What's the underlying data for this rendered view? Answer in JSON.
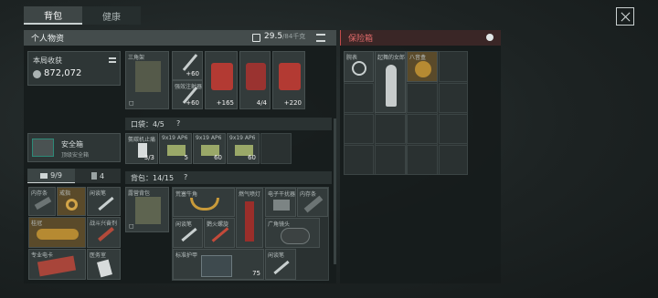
{
  "tabs": [
    "背包",
    "健康"
  ],
  "personal": {
    "title": "个人物资",
    "weight_current": "29.5",
    "weight_max": "/84千克",
    "session_title": "本局收获",
    "session_value": "872,072",
    "safebox_title": "安全箱",
    "safebox_sub": "顶级安全箱",
    "tab_counts": [
      "9/9",
      "4"
    ]
  },
  "vault": {
    "title": "保险箱"
  },
  "top_items": [
    {
      "label": "三角架",
      "qty": "+60"
    },
    {
      "label": "",
      "qty": "+60"
    },
    {
      "label": "",
      "qty": "+165"
    },
    {
      "label": "",
      "qty": "4/4"
    },
    {
      "label": "",
      "qty": "+220"
    }
  ],
  "top_sub_label": "强效注射器",
  "pocket": {
    "title": "口袋：4/5",
    "help": "?",
    "items": [
      {
        "label": "氨碳机止痛",
        "qty": "3/3"
      },
      {
        "label": "9x19 AP6",
        "qty": "5"
      },
      {
        "label": "9x19 AP6",
        "qty": "60"
      },
      {
        "label": "9x19 AP6",
        "qty": "60"
      }
    ]
  },
  "backpack": {
    "title": "背包：14/15",
    "help": "?",
    "rig_label": "露营背包",
    "items": [
      "荒塞牛角",
      "燃气喷灯",
      "电子干扰器",
      "内存条",
      "闲谈笔",
      "鹦火螺旋",
      "广角镜头",
      "标准护甲",
      "闲谈笔"
    ],
    "armor_qty": "75"
  },
  "safebox_items": [
    {
      "label": "内存条"
    },
    {
      "label": "戒指"
    },
    {
      "label": "闲谈笔"
    },
    {
      "label": "桂冠"
    },
    {
      "label": "战斗兴奋剂"
    },
    {
      "label": "专业电卡"
    },
    {
      "label": "医务室"
    }
  ],
  "vault_items": [
    "腕表",
    "起舞的女郎",
    "八音盒"
  ],
  "colors": {
    "vault_accent": "#c24a4a",
    "gold": "#c89a3a",
    "red_box": "#b33a33"
  }
}
